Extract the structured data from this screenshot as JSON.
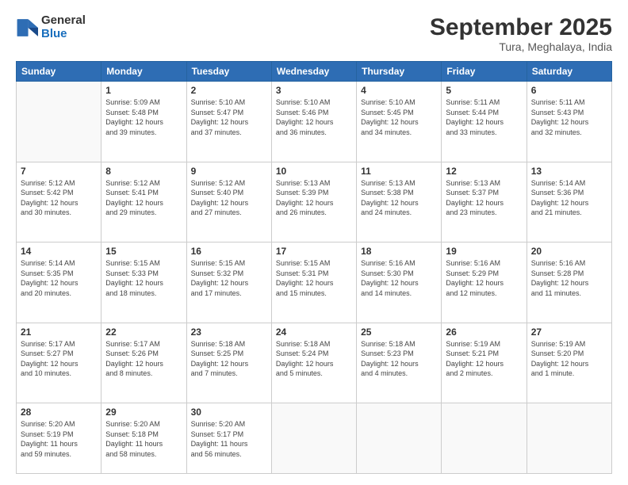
{
  "logo": {
    "general": "General",
    "blue": "Blue"
  },
  "title": "September 2025",
  "location": "Tura, Meghalaya, India",
  "days_of_week": [
    "Sunday",
    "Monday",
    "Tuesday",
    "Wednesday",
    "Thursday",
    "Friday",
    "Saturday"
  ],
  "weeks": [
    [
      {
        "day": "",
        "info": ""
      },
      {
        "day": "1",
        "info": "Sunrise: 5:09 AM\nSunset: 5:48 PM\nDaylight: 12 hours\nand 39 minutes."
      },
      {
        "day": "2",
        "info": "Sunrise: 5:10 AM\nSunset: 5:47 PM\nDaylight: 12 hours\nand 37 minutes."
      },
      {
        "day": "3",
        "info": "Sunrise: 5:10 AM\nSunset: 5:46 PM\nDaylight: 12 hours\nand 36 minutes."
      },
      {
        "day": "4",
        "info": "Sunrise: 5:10 AM\nSunset: 5:45 PM\nDaylight: 12 hours\nand 34 minutes."
      },
      {
        "day": "5",
        "info": "Sunrise: 5:11 AM\nSunset: 5:44 PM\nDaylight: 12 hours\nand 33 minutes."
      },
      {
        "day": "6",
        "info": "Sunrise: 5:11 AM\nSunset: 5:43 PM\nDaylight: 12 hours\nand 32 minutes."
      }
    ],
    [
      {
        "day": "7",
        "info": "Sunrise: 5:12 AM\nSunset: 5:42 PM\nDaylight: 12 hours\nand 30 minutes."
      },
      {
        "day": "8",
        "info": "Sunrise: 5:12 AM\nSunset: 5:41 PM\nDaylight: 12 hours\nand 29 minutes."
      },
      {
        "day": "9",
        "info": "Sunrise: 5:12 AM\nSunset: 5:40 PM\nDaylight: 12 hours\nand 27 minutes."
      },
      {
        "day": "10",
        "info": "Sunrise: 5:13 AM\nSunset: 5:39 PM\nDaylight: 12 hours\nand 26 minutes."
      },
      {
        "day": "11",
        "info": "Sunrise: 5:13 AM\nSunset: 5:38 PM\nDaylight: 12 hours\nand 24 minutes."
      },
      {
        "day": "12",
        "info": "Sunrise: 5:13 AM\nSunset: 5:37 PM\nDaylight: 12 hours\nand 23 minutes."
      },
      {
        "day": "13",
        "info": "Sunrise: 5:14 AM\nSunset: 5:36 PM\nDaylight: 12 hours\nand 21 minutes."
      }
    ],
    [
      {
        "day": "14",
        "info": "Sunrise: 5:14 AM\nSunset: 5:35 PM\nDaylight: 12 hours\nand 20 minutes."
      },
      {
        "day": "15",
        "info": "Sunrise: 5:15 AM\nSunset: 5:33 PM\nDaylight: 12 hours\nand 18 minutes."
      },
      {
        "day": "16",
        "info": "Sunrise: 5:15 AM\nSunset: 5:32 PM\nDaylight: 12 hours\nand 17 minutes."
      },
      {
        "day": "17",
        "info": "Sunrise: 5:15 AM\nSunset: 5:31 PM\nDaylight: 12 hours\nand 15 minutes."
      },
      {
        "day": "18",
        "info": "Sunrise: 5:16 AM\nSunset: 5:30 PM\nDaylight: 12 hours\nand 14 minutes."
      },
      {
        "day": "19",
        "info": "Sunrise: 5:16 AM\nSunset: 5:29 PM\nDaylight: 12 hours\nand 12 minutes."
      },
      {
        "day": "20",
        "info": "Sunrise: 5:16 AM\nSunset: 5:28 PM\nDaylight: 12 hours\nand 11 minutes."
      }
    ],
    [
      {
        "day": "21",
        "info": "Sunrise: 5:17 AM\nSunset: 5:27 PM\nDaylight: 12 hours\nand 10 minutes."
      },
      {
        "day": "22",
        "info": "Sunrise: 5:17 AM\nSunset: 5:26 PM\nDaylight: 12 hours\nand 8 minutes."
      },
      {
        "day": "23",
        "info": "Sunrise: 5:18 AM\nSunset: 5:25 PM\nDaylight: 12 hours\nand 7 minutes."
      },
      {
        "day": "24",
        "info": "Sunrise: 5:18 AM\nSunset: 5:24 PM\nDaylight: 12 hours\nand 5 minutes."
      },
      {
        "day": "25",
        "info": "Sunrise: 5:18 AM\nSunset: 5:23 PM\nDaylight: 12 hours\nand 4 minutes."
      },
      {
        "day": "26",
        "info": "Sunrise: 5:19 AM\nSunset: 5:21 PM\nDaylight: 12 hours\nand 2 minutes."
      },
      {
        "day": "27",
        "info": "Sunrise: 5:19 AM\nSunset: 5:20 PM\nDaylight: 12 hours\nand 1 minute."
      }
    ],
    [
      {
        "day": "28",
        "info": "Sunrise: 5:20 AM\nSunset: 5:19 PM\nDaylight: 11 hours\nand 59 minutes."
      },
      {
        "day": "29",
        "info": "Sunrise: 5:20 AM\nSunset: 5:18 PM\nDaylight: 11 hours\nand 58 minutes."
      },
      {
        "day": "30",
        "info": "Sunrise: 5:20 AM\nSunset: 5:17 PM\nDaylight: 11 hours\nand 56 minutes."
      },
      {
        "day": "",
        "info": ""
      },
      {
        "day": "",
        "info": ""
      },
      {
        "day": "",
        "info": ""
      },
      {
        "day": "",
        "info": ""
      }
    ]
  ]
}
